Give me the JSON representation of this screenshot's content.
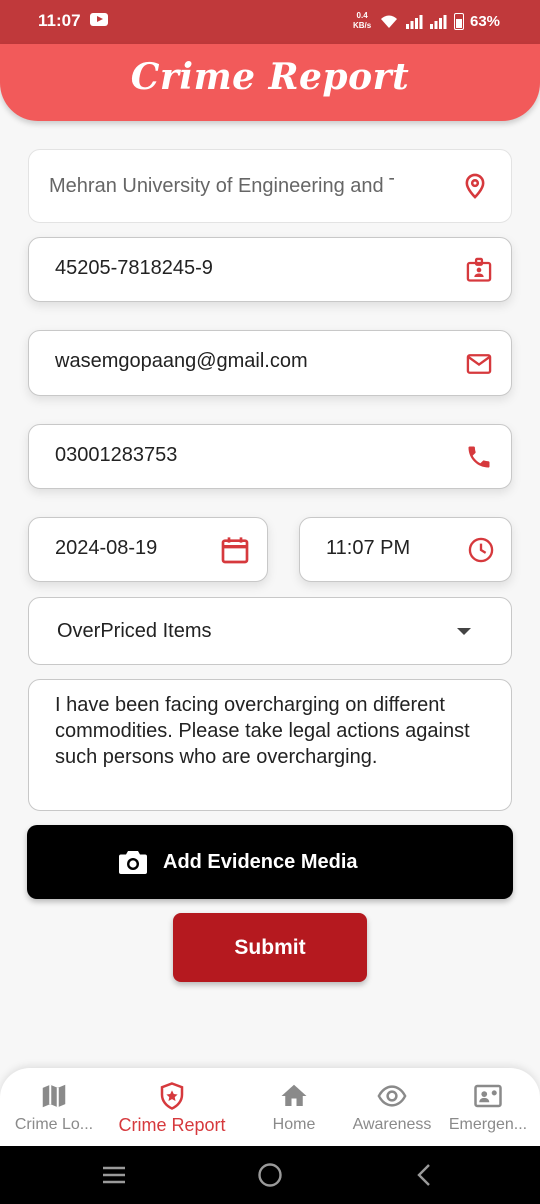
{
  "status_bar": {
    "time": "11:07",
    "net_speed_value": "0.4",
    "net_speed_unit": "KB/s",
    "battery": "63%"
  },
  "header": {
    "title": "Crime Report"
  },
  "form": {
    "location": "Mehran University of Engineering and Technology",
    "cnic": "45205-7818245-9",
    "email": "wasemgopaang@gmail.com",
    "phone": "03001283753",
    "date": "2024-08-19",
    "time": "11:07 PM",
    "category": "OverPriced Items",
    "description": "I have been facing overcharging on different commodities. Please take legal actions against such persons who are overcharging."
  },
  "buttons": {
    "evidence_label": "Add Evidence Media",
    "submit_label": "Submit"
  },
  "bottom_nav": {
    "items": [
      {
        "label": "Crime Lo...",
        "icon": "map-icon",
        "active": false
      },
      {
        "label": "Crime Report",
        "icon": "shield-star-icon",
        "active": true
      },
      {
        "label": "Home",
        "icon": "home-icon",
        "active": false
      },
      {
        "label": "Awareness",
        "icon": "eye-icon",
        "active": false
      },
      {
        "label": "Emergen...",
        "icon": "contact-card-icon",
        "active": false
      }
    ]
  },
  "colors": {
    "status_bar": "#c0393b",
    "header": "#f25a5a",
    "accent": "#d6393d",
    "submit": "#b5191f",
    "evidence_button": "#000000"
  }
}
